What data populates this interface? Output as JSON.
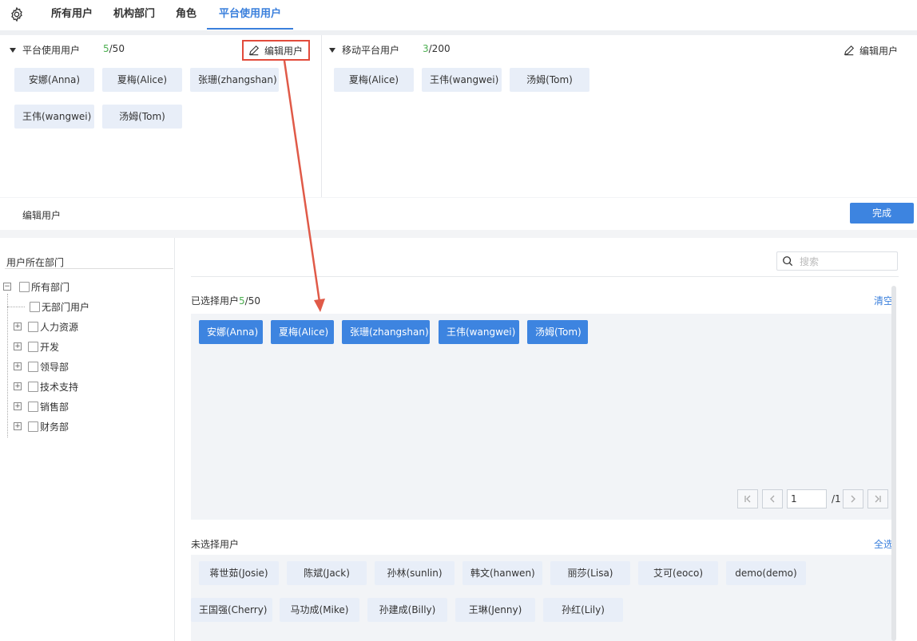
{
  "nav": {
    "tabs": [
      {
        "label": "所有用户"
      },
      {
        "label": "机构部门"
      },
      {
        "label": "角色"
      },
      {
        "label": "平台使用用户"
      }
    ]
  },
  "platform_panel": {
    "title": "平台使用用户",
    "count_used": "5",
    "count_total": "/50",
    "edit_label": "编辑用户",
    "users": [
      "安娜(Anna)",
      "夏梅(Alice)",
      "张珊(zhangshan)",
      "王伟(wangwei)",
      "汤姆(Tom)"
    ]
  },
  "mobile_panel": {
    "title": "移动平台用户",
    "count_used": "3",
    "count_total": "/200",
    "edit_label": "编辑用户",
    "users": [
      "夏梅(Alice)",
      "王伟(wangwei)",
      "汤姆(Tom)"
    ]
  },
  "edit_bar": {
    "title": "编辑用户",
    "done_label": "完成"
  },
  "tree": {
    "title": "用户所在部门",
    "root": "所有部门",
    "items": [
      "无部门用户",
      "人力资源",
      "开发",
      "领导部",
      "技术支持",
      "销售部",
      "财务部"
    ]
  },
  "search": {
    "placeholder": "搜索"
  },
  "selected": {
    "label": "已选择用户",
    "count_used": "5",
    "count_total": "/50",
    "clear_label": "清空",
    "users": [
      "安娜(Anna)",
      "夏梅(Alice)",
      "张珊(zhangshan)",
      "王伟(wangwei)",
      "汤姆(Tom)"
    ],
    "pager": {
      "page": "1",
      "total": "/1"
    }
  },
  "unselected": {
    "label": "未选择用户",
    "select_all_label": "全选",
    "users": [
      "蒋世茹(Josie)",
      "陈斌(Jack)",
      "孙林(sunlin)",
      "韩文(hanwen)",
      "丽莎(Lisa)",
      "艾可(eoco)",
      "demo(demo)",
      "王国强(Cherry)",
      "马功成(Mike)",
      "孙建成(Billy)",
      "王琳(Jenny)",
      "孙红(Lily)"
    ]
  },
  "colors": {
    "accent": "#3d84e0",
    "highlight_box": "#e24b3b",
    "count_green": "#4caf50"
  }
}
